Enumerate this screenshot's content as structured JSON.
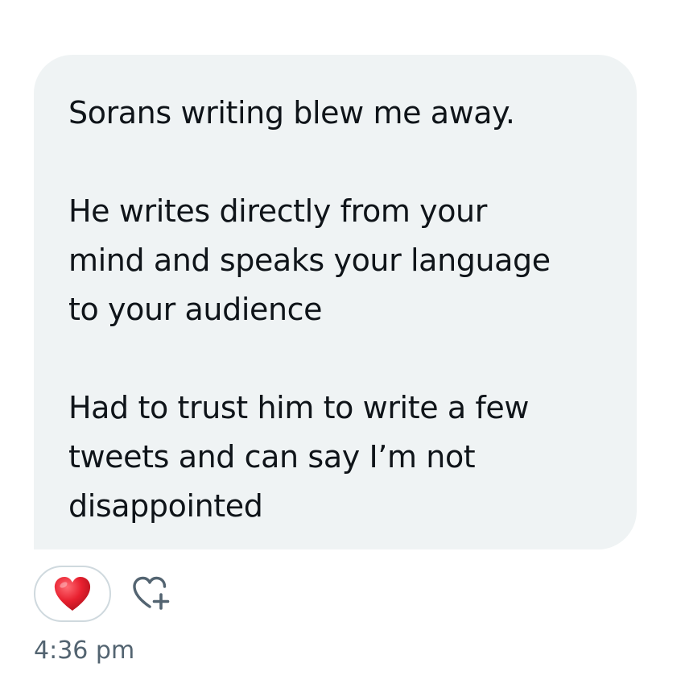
{
  "message": {
    "paragraphs": [
      "Sorans writing blew me away.",
      "He writes directly from your\nmind and speaks your language\nto your audience",
      "Had to trust him to write a few\ntweets and can say I’m not\ndisappointed"
    ],
    "bubble_color": "#eff3f4",
    "text_color": "#0f1419"
  },
  "reactions": {
    "current_reaction_icon": "red-heart-emoji",
    "add_reaction_icon": "heart-plus-icon",
    "heart_color": "#e8202f"
  },
  "timestamp": {
    "text": "4:36 pm",
    "color": "#536471"
  }
}
